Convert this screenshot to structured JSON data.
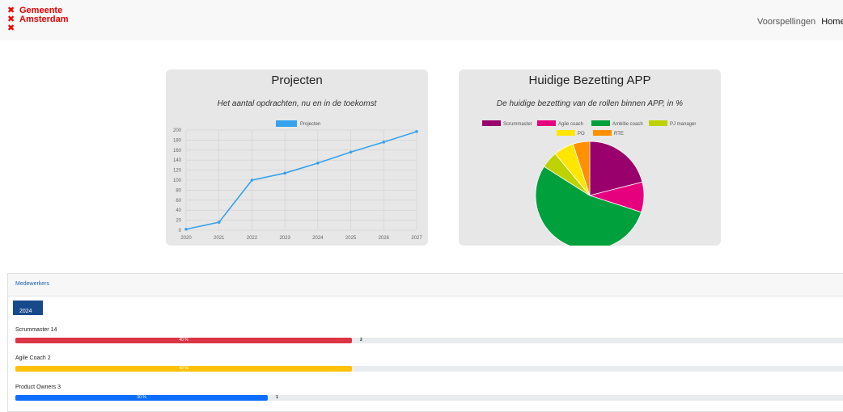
{
  "header": {
    "logo_line1": "Gemeente",
    "logo_line2": "Amsterdam",
    "nav_items": [
      "Voorspellingen",
      "Home"
    ]
  },
  "projects_card": {
    "title": "Projecten",
    "subtitle": "Het aantal opdrachten, nu en in de toekomst"
  },
  "bezetting_card": {
    "title": "Huidige Bezetting APP",
    "subtitle": "De huidige bezetting van de rollen binnen APP, in %"
  },
  "chart_data": [
    {
      "type": "line",
      "title": "",
      "x": [
        "2020",
        "2021",
        "2022",
        "2023",
        "2024",
        "2025",
        "2026",
        "2027"
      ],
      "series": [
        {
          "name": "Projecten",
          "values": [
            2,
            16,
            100,
            114,
            134,
            156,
            176,
            197
          ],
          "color": "#36a2eb"
        }
      ],
      "ylim": [
        0,
        200
      ],
      "yticks": [
        0,
        20,
        40,
        60,
        80,
        100,
        120,
        140,
        160,
        180,
        200
      ],
      "grid": true,
      "legend": "top"
    },
    {
      "type": "pie",
      "title": "",
      "categories": [
        "Scrummaster",
        "Agile coach",
        "Ambitie coach",
        "PJ manager",
        "PO",
        "RTE"
      ],
      "values": [
        21,
        9,
        54,
        5,
        6,
        5
      ],
      "colors": [
        "#99006b",
        "#e6007e",
        "#00a03c",
        "#bed200",
        "#ffe600",
        "#ff9100"
      ],
      "legend": "top"
    }
  ],
  "medewerkers": {
    "title": "Medewerkers",
    "year": "2024",
    "rows": [
      {
        "label": "Scrummaster 14",
        "percent_text": "40 %",
        "fraction": 0.4,
        "count": "2",
        "color": "#dc3545"
      },
      {
        "label": "Agile Coach 2",
        "percent_text": "40 %",
        "fraction": 0.4,
        "count": "",
        "color": "#ffc107"
      },
      {
        "label": "Product Owners 3",
        "percent_text": "30 %",
        "fraction": 0.3,
        "count": "1",
        "color": "#0d6efd"
      }
    ]
  }
}
